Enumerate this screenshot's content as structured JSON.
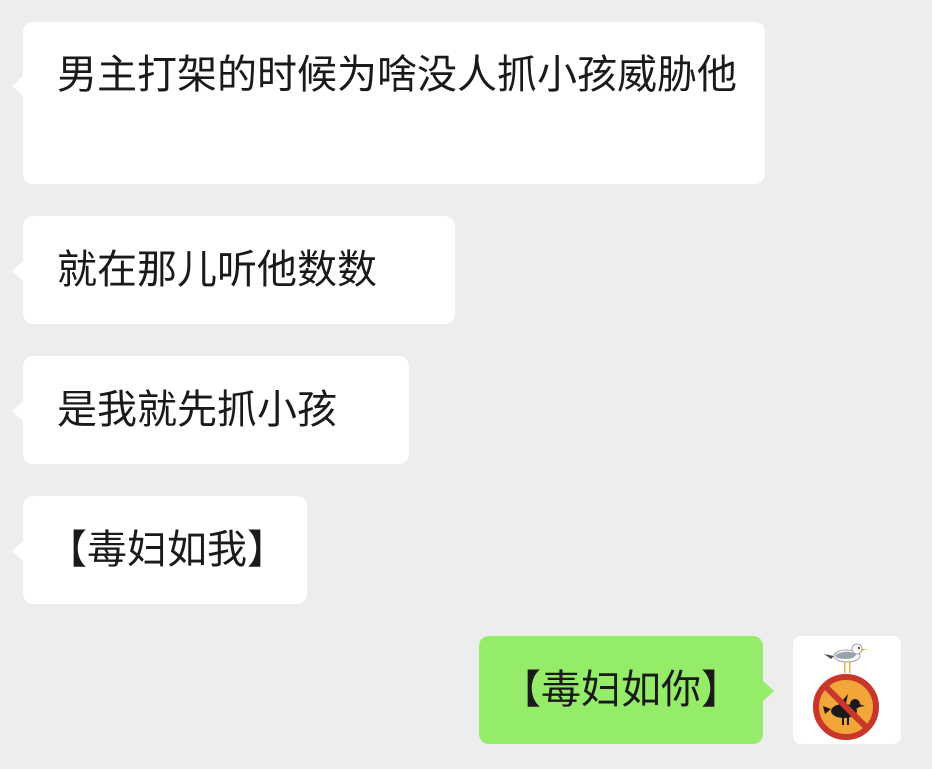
{
  "conversation": {
    "messages": [
      {
        "sender": "other",
        "text": "男主打架的时候为啥没人抓小孩威胁他"
      },
      {
        "sender": "other",
        "text": "就在那儿听他数数"
      },
      {
        "sender": "other",
        "text": "是我就先抓小孩"
      },
      {
        "sender": "other",
        "text": "【毒妇如我】"
      },
      {
        "sender": "self",
        "text": "【毒妇如你】"
      }
    ]
  },
  "avatar": {
    "icon": "no-seagull-sign-icon",
    "colors": {
      "ring": "#c9362b",
      "disc": "#f2a63a",
      "bird": "#1a1a1a",
      "seagull_body": "#ffffff",
      "seagull_wing": "#9aa3ad"
    }
  },
  "colors": {
    "background": "#ededed",
    "received_bubble": "#ffffff",
    "sent_bubble": "#95ec69",
    "text": "#1a1a1a"
  }
}
